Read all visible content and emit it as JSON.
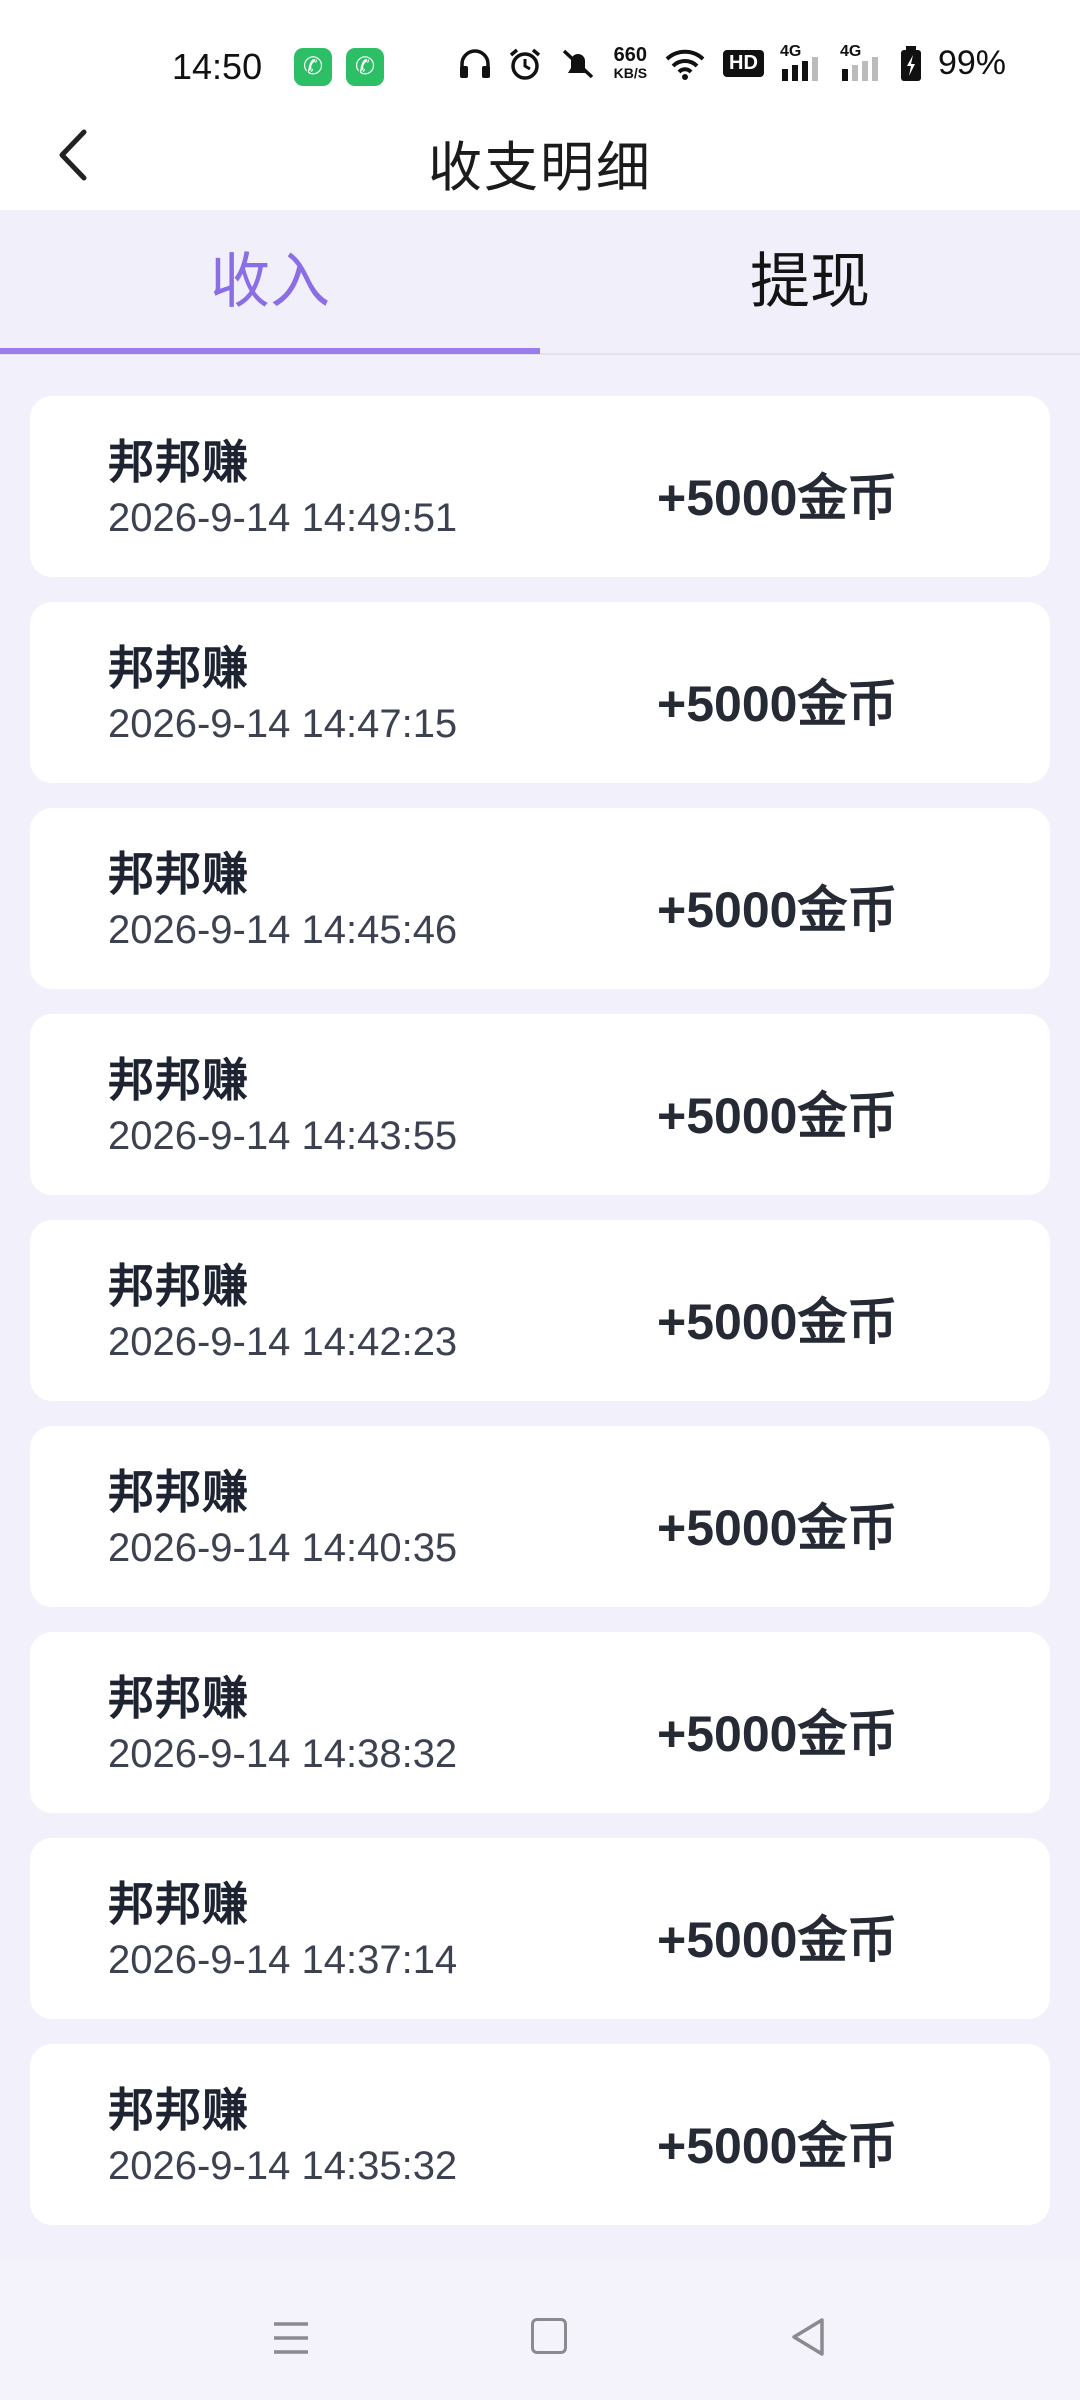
{
  "status_bar": {
    "time": "14:50",
    "net_speed_top": "660",
    "net_speed_bottom": "KB/S",
    "signal_label_1": "4G",
    "signal_label_2": "4G",
    "hd_label": "HD",
    "battery": "99%",
    "icons": [
      "phone-app-icon",
      "phone-app-icon",
      "headphones-icon",
      "alarm-icon",
      "mute-icon",
      "wifi-icon",
      "hd-icon",
      "signal-icon",
      "signal-icon",
      "battery-icon"
    ]
  },
  "header": {
    "title": "收支明细",
    "back_icon": "chevron-left-icon"
  },
  "tabs": [
    {
      "label": "收入",
      "active": true
    },
    {
      "label": "提现",
      "active": false
    }
  ],
  "colors": {
    "accent": "#8a6ee6",
    "background": "#f2f1fb",
    "card": "#ffffff"
  },
  "records": [
    {
      "name": "邦邦赚",
      "time": "2026-9-14 14:49:51",
      "amount": "+5000金币"
    },
    {
      "name": "邦邦赚",
      "time": "2026-9-14 14:47:15",
      "amount": "+5000金币"
    },
    {
      "name": "邦邦赚",
      "time": "2026-9-14 14:45:46",
      "amount": "+5000金币"
    },
    {
      "name": "邦邦赚",
      "time": "2026-9-14 14:43:55",
      "amount": "+5000金币"
    },
    {
      "name": "邦邦赚",
      "time": "2026-9-14 14:42:23",
      "amount": "+5000金币"
    },
    {
      "name": "邦邦赚",
      "time": "2026-9-14 14:40:35",
      "amount": "+5000金币"
    },
    {
      "name": "邦邦赚",
      "time": "2026-9-14 14:38:32",
      "amount": "+5000金币"
    },
    {
      "name": "邦邦赚",
      "time": "2026-9-14 14:37:14",
      "amount": "+5000金币"
    },
    {
      "name": "邦邦赚",
      "time": "2026-9-14 14:35:32",
      "amount": "+5000金币"
    }
  ],
  "nav_bar": {
    "icons": [
      "menu-icon",
      "home-icon",
      "back-triangle-icon"
    ]
  }
}
